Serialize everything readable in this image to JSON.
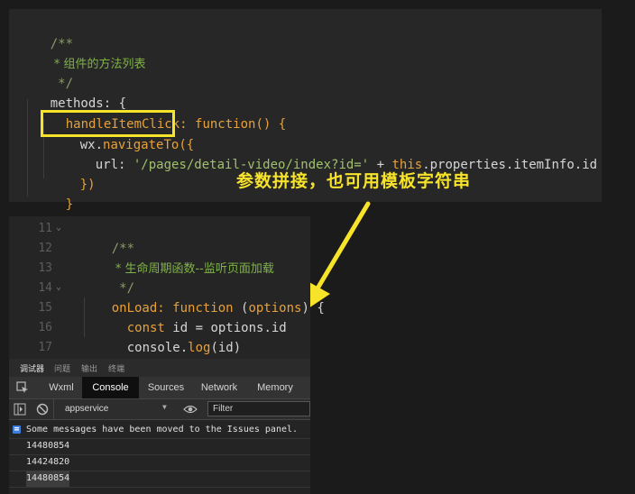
{
  "top_editor": {
    "lines": [
      {
        "t1": "/**"
      },
      {
        "t1": " * 组件的方法列表"
      },
      {
        "t1": " */"
      },
      {
        "t1": "methods: {"
      },
      {
        "t1": "handleItemClick",
        "t2": ": ",
        "t3": "function",
        "t4": "() {"
      },
      {
        "t1": "wx.",
        "t2": "navigateTo",
        "t3": "({"
      },
      {
        "t1": "url: ",
        "t2": "'/pages/detail-video/index?id='",
        "t3": " + ",
        "t4": "this",
        "t5": ".properties.itemInfo.id"
      },
      {
        "t1": "})"
      },
      {
        "t1": "}"
      }
    ]
  },
  "annotation": "参数拼接，也可用模板字符串",
  "bottom_editor": {
    "line_numbers": [
      "11",
      "12",
      "13",
      "14",
      "15",
      "16",
      "17"
    ],
    "lines": [
      {
        "t1": "/**"
      },
      {
        "t1": " * 生命周期函数--监听页面加载"
      },
      {
        "t1": " */"
      },
      {
        "t1": "onLoad",
        "t2": ": ",
        "t3": "function",
        "t4": " (",
        "t5": "options",
        "t6": ") {"
      },
      {
        "t1": "const",
        "t2": " id = options.id"
      },
      {
        "t1": "console.",
        "t2": "log",
        "t3": "(id)"
      },
      {
        "t1": "},"
      }
    ]
  },
  "devtools": {
    "panel_tabs": [
      "调试器",
      "问题",
      "输出",
      "终端"
    ],
    "tool_tabs": [
      "Wxml",
      "Console",
      "Sources",
      "Network",
      "Memory"
    ],
    "active_tab": "Console",
    "context": "appservice",
    "filter_placeholder": "Filter",
    "messages": [
      "Some messages have been moved to the Issues panel.",
      "14480854",
      "14424820",
      "14480854"
    ]
  },
  "colors": {
    "highlight": "#f6e32a",
    "keyword": "#e8a13a",
    "string": "#9fc26b",
    "comment": "#8b9a6a"
  }
}
